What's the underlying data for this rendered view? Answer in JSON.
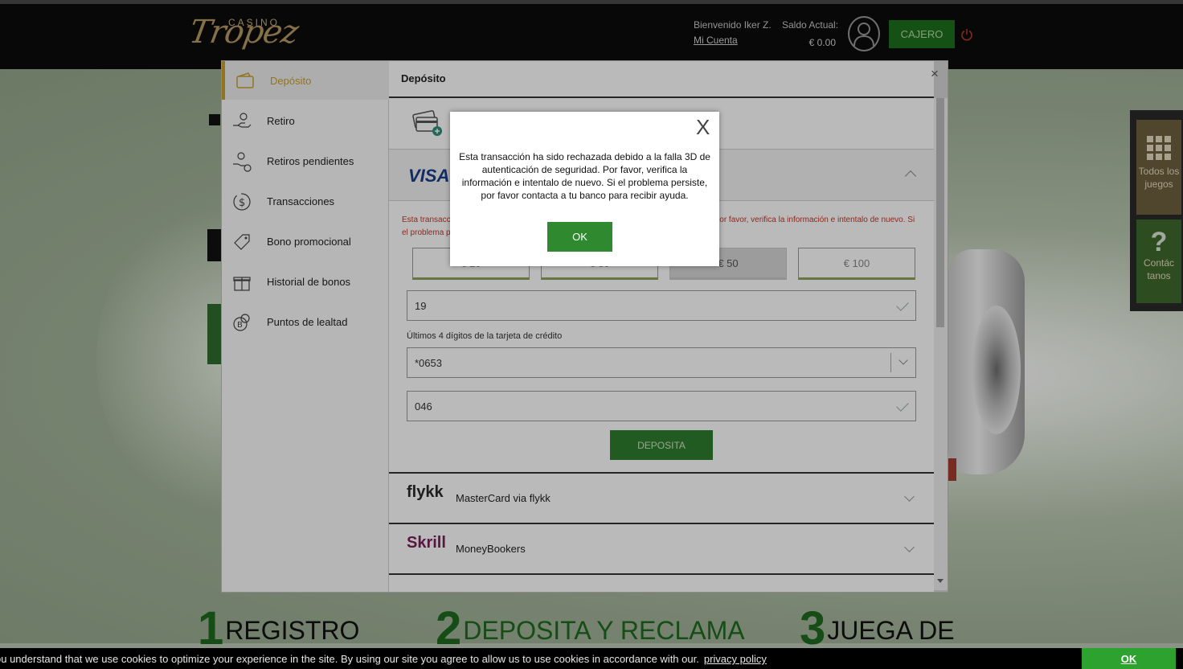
{
  "header": {
    "logo_top": "CASINO",
    "logo_main": "Tropez",
    "welcome": "Bienvenido  Iker Z.",
    "account_link": "Mi Cuenta",
    "balance_label": "Saldo Actual:",
    "balance_value": "€ 0.00",
    "cashier_label": "CAJERO"
  },
  "background": {
    "steps": [
      {
        "num": "1",
        "label": "REGISTRO"
      },
      {
        "num": "2",
        "label": "DEPOSITA Y RECLAMA"
      },
      {
        "num": "3",
        "label": "JUEGA DE"
      }
    ]
  },
  "side_menu": {
    "all_games": "Todos los juegos",
    "contact": "Contác tanos"
  },
  "cashier_modal": {
    "nav": [
      {
        "label": "Depósito",
        "icon": "wallet-icon"
      },
      {
        "label": "Retiro",
        "icon": "hand-coin-icon"
      },
      {
        "label": "Retiros pendientes",
        "icon": "hand-clock-icon"
      },
      {
        "label": "Transacciones",
        "icon": "dollar-cycle-icon"
      },
      {
        "label": "Bono promocional",
        "icon": "tag-icon"
      },
      {
        "label": "Historial de bonos",
        "icon": "gift-icon"
      },
      {
        "label": "Puntos de lealtad",
        "icon": "points-coin-icon"
      }
    ],
    "title": "Depósito",
    "close": "×",
    "visa_logo": "VISA",
    "error_text": "Esta transacción ha sido rechazada debido a la falla 3D de autenticación de seguridad. Por favor, verifica la información e intentalo de nuevo. Si el problema persiste, por favor contacta a tu banco para recibir ayuda.",
    "amounts": [
      "€ 20",
      "€ 30",
      "€ 50",
      "€ 100"
    ],
    "selected_amount_index": 2,
    "month_value": "19",
    "last4_label": "Últimos 4 dígitos de la tarjeta de crédito",
    "last4_value": "*0653",
    "cvv_value": "046",
    "deposit_button": "DEPOSITA",
    "methods": [
      {
        "logo": "flykk",
        "name": "MasterCard via flykk"
      },
      {
        "logo": "Skrill",
        "name": "MoneyBookers"
      }
    ]
  },
  "alert": {
    "close": "X",
    "message": "Esta transacción ha sido rechazada debido a la falla 3D de autenticación de seguridad. Por favor, verifica la información e intentalo de nuevo. Si el problema persiste, por favor contacta a tu banco para recibir ayuda.",
    "ok": "OK"
  },
  "cookie_bar": {
    "text": "ou understand that we use cookies to optimize your experience in the site. By using our site you agree to allow us to use cookies in accordance with our.",
    "link": "privacy policy",
    "ok": "OK"
  },
  "colors": {
    "accent_green": "#2f8a2f",
    "active_gold": "#c9a02a",
    "error_red": "#c0392b"
  }
}
